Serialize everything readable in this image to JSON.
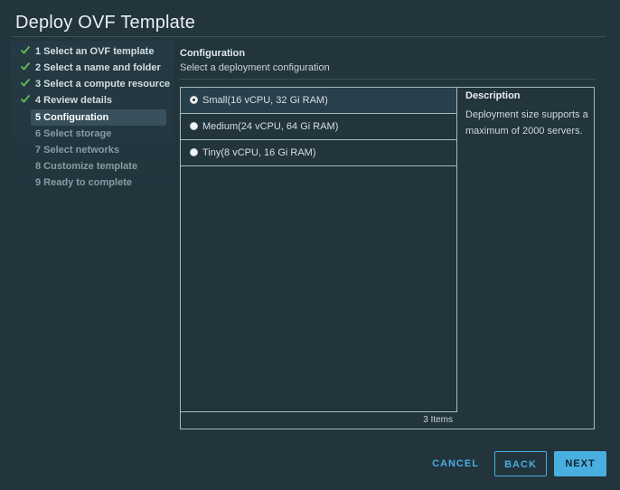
{
  "dialog": {
    "title": "Deploy OVF Template"
  },
  "colors": {
    "accent": "#49aee0",
    "check": "#5fbf5a",
    "background": "#22343c"
  },
  "steps": [
    {
      "label": "1 Select an OVF template",
      "status": "done",
      "icon": "check-icon"
    },
    {
      "label": "2 Select a name and folder",
      "status": "done",
      "icon": "check-icon"
    },
    {
      "label": "3 Select a compute resource",
      "status": "done",
      "icon": "check-icon"
    },
    {
      "label": "4 Review details",
      "status": "done",
      "icon": "check-icon"
    },
    {
      "label": "5 Configuration",
      "status": "active"
    },
    {
      "label": "6 Select storage",
      "status": "future"
    },
    {
      "label": "7 Select networks",
      "status": "future"
    },
    {
      "label": "8 Customize template",
      "status": "future"
    },
    {
      "label": "9 Ready to complete",
      "status": "future"
    }
  ],
  "content": {
    "title": "Configuration",
    "subtitle": "Select a deployment configuration"
  },
  "options": [
    {
      "label": "Small(16 vCPU, 32 Gi RAM)",
      "selected": true
    },
    {
      "label": "Medium(24 vCPU, 64 Gi RAM)",
      "selected": false
    },
    {
      "label": "Tiny(8 vCPU, 16 Gi RAM)",
      "selected": false
    }
  ],
  "list_footer": {
    "count": "3 Items"
  },
  "description": {
    "heading": "Description",
    "text": "Deployment size supports a maximum of 2000 servers."
  },
  "buttons": {
    "cancel": "CANCEL",
    "back": "BACK",
    "next": "NEXT"
  }
}
